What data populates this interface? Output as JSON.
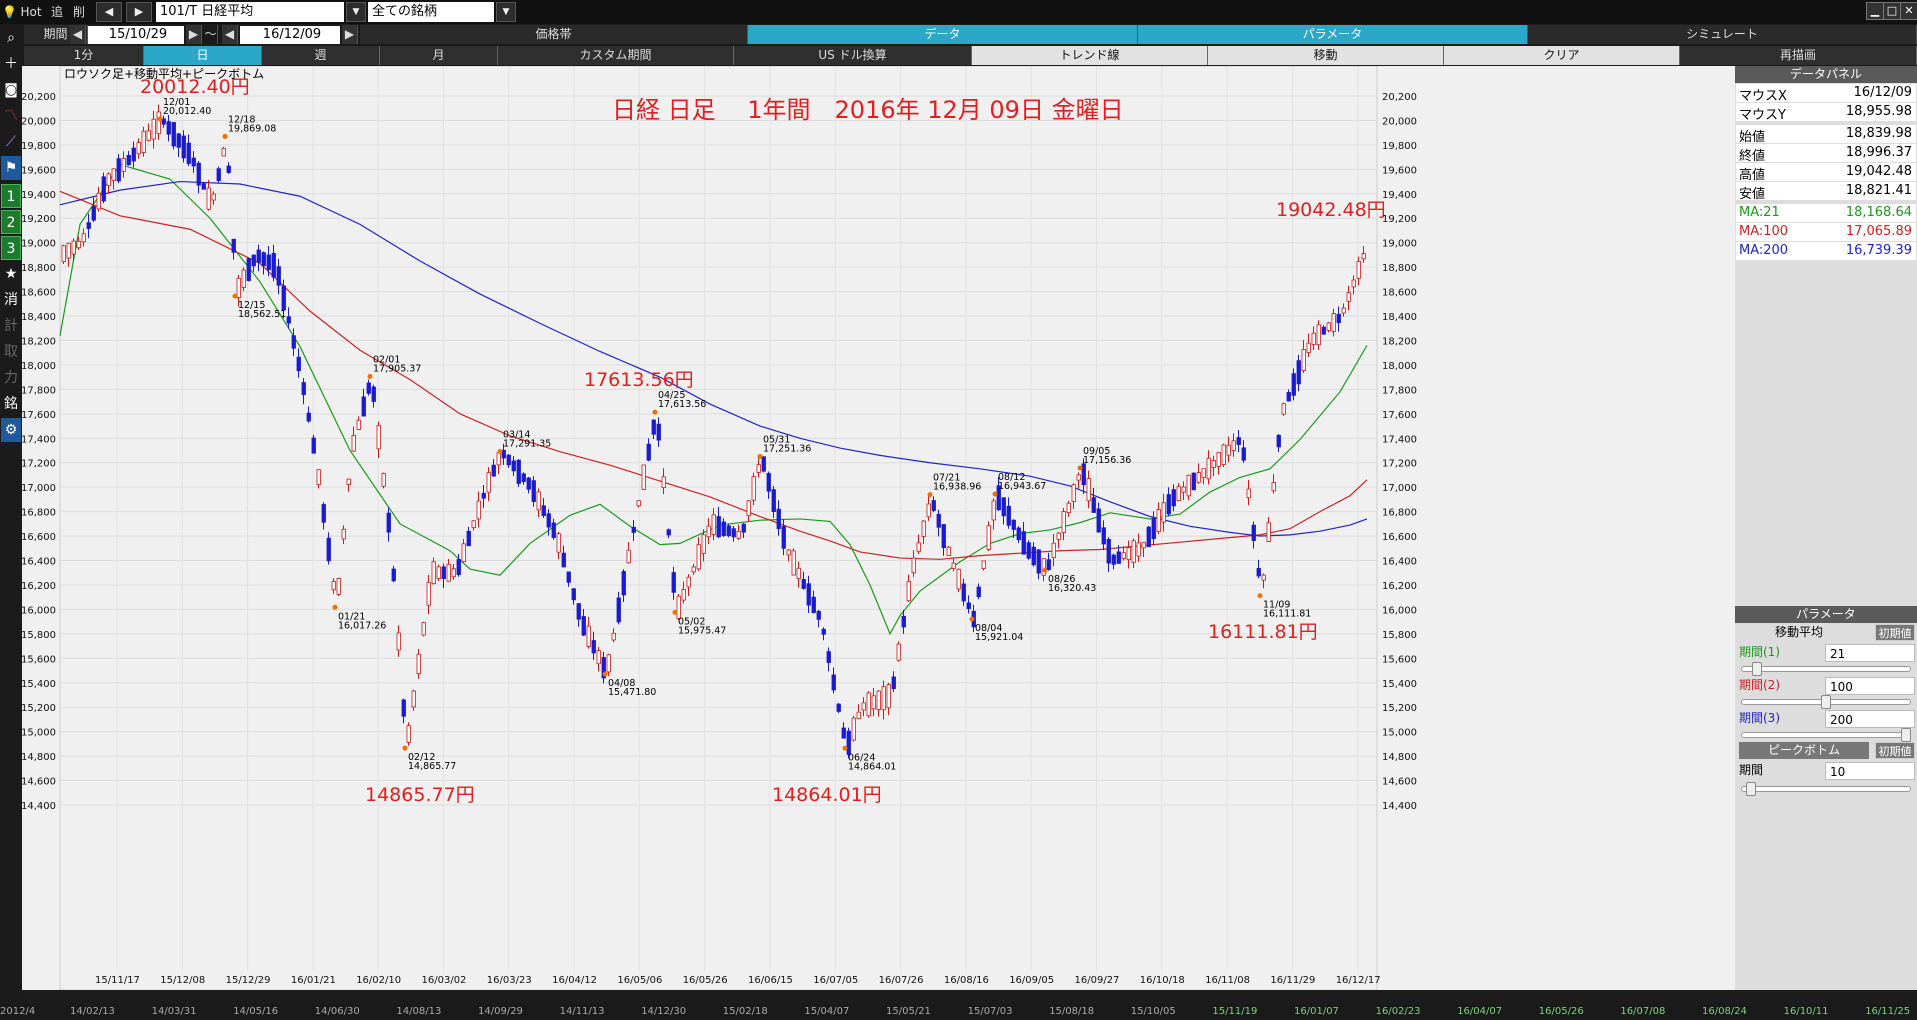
{
  "topbar": {
    "hot": "Hot",
    "tsui": "追",
    "sakujo": "削",
    "symbol": "101/T 日経平均",
    "filter": "全ての銘柄"
  },
  "period_bar": {
    "label": "期間",
    "start": "15/10/29",
    "sep": "～",
    "end": "16/12/09",
    "tabs": [
      "価格帯",
      "データ",
      "パラメータ",
      "シミュレート"
    ],
    "active_tab": "データ"
  },
  "interval_bar": {
    "items": [
      "1分",
      "日",
      "週",
      "月",
      "カスタム期間",
      "US ドル換算",
      "トレンド線",
      "移動",
      "クリア",
      "再描画"
    ],
    "active": "日"
  },
  "toolbar_icons": [
    "search-icon",
    "crosshair-icon",
    "camera-icon",
    "line-chart-icon",
    "trend-icon",
    "flag-icon",
    "1",
    "2",
    "3",
    "star-icon",
    "消",
    "計",
    "取",
    "力",
    "銘",
    "gear-icon"
  ],
  "chart_data": {
    "type": "candlestick",
    "subtitle": "ロウソク足+移動平均+ピークボトム",
    "title": "日経 日足　 1年間　2016年 12月 09日 金曜日",
    "ylim": [
      14400,
      20200
    ],
    "y_ticks": [
      "20,200",
      "20,000",
      "19,800",
      "19,600",
      "19,400",
      "19,200",
      "19,000",
      "18,800",
      "18,600",
      "18,400",
      "18,200",
      "18,000",
      "17,800",
      "17,600",
      "17,400",
      "17,200",
      "17,000",
      "16,800",
      "16,600",
      "16,400",
      "16,200",
      "16,000",
      "15,800",
      "15,600",
      "15,400",
      "15,200",
      "15,000",
      "14,800",
      "14,600",
      "14,400"
    ],
    "x_ticks": [
      "15/11/17",
      "15/12/08",
      "15/12/29",
      "16/01/21",
      "16/02/10",
      "16/03/02",
      "16/03/23",
      "16/04/12",
      "16/05/06",
      "16/05/26",
      "16/06/15",
      "16/07/05",
      "16/07/26",
      "16/08/16",
      "16/09/05",
      "16/09/27",
      "16/10/18",
      "16/11/08",
      "16/11/29",
      "16/12/17"
    ],
    "bottom_ticks": [
      "2012/4",
      "14/02/13",
      "14/03/31",
      "14/05/16",
      "14/06/30",
      "14/08/13",
      "14/09/29",
      "14/11/13",
      "14/12/30",
      "15/02/18",
      "15/04/07",
      "15/05/21",
      "15/07/03",
      "15/08/18",
      "15/10/05",
      "15/11/19",
      "16/01/07",
      "16/02/23",
      "16/04/07",
      "16/05/26",
      "16/07/08",
      "16/08/24",
      "16/10/11",
      "16/11/25"
    ],
    "big_labels": [
      {
        "text": "20012.40円",
        "x": 0,
        "v": 20012.4
      },
      {
        "text": "17613.56円",
        "x": 0,
        "v": 17613.56
      },
      {
        "text": "19042.48円",
        "x": 0,
        "v": 19042.48
      },
      {
        "text": "14865.77円",
        "x": 0,
        "v": 14865.77
      },
      {
        "text": "14864.01円",
        "x": 0,
        "v": 14864.01
      },
      {
        "text": "16111.81円",
        "x": 0,
        "v": 16111.81
      }
    ],
    "peaks": [
      {
        "date": "12/01",
        "value": "20,012.40",
        "v": 20012.4,
        "type": "peak"
      },
      {
        "date": "12/18",
        "value": "19,869.08",
        "v": 19869.08,
        "type": "peak"
      },
      {
        "date": "12/15",
        "value": "18,562.51",
        "v": 18562.51,
        "type": "bottom"
      },
      {
        "date": "02/01",
        "value": "17,905.37",
        "v": 17905.37,
        "type": "peak"
      },
      {
        "date": "01/21",
        "value": "16,017.26",
        "v": 16017.26,
        "type": "bottom"
      },
      {
        "date": "02/12",
        "value": "14,865.77",
        "v": 14865.77,
        "type": "bottom"
      },
      {
        "date": "03/14",
        "value": "17,291.35",
        "v": 17291.35,
        "type": "peak"
      },
      {
        "date": "04/08",
        "value": "15,471.80",
        "v": 15471.8,
        "type": "bottom"
      },
      {
        "date": "04/25",
        "value": "17,613.56",
        "v": 17613.56,
        "type": "peak"
      },
      {
        "date": "05/02",
        "value": "15,975.47",
        "v": 15975.47,
        "type": "bottom"
      },
      {
        "date": "05/31",
        "value": "17,251.36",
        "v": 17251.36,
        "type": "peak"
      },
      {
        "date": "06/24",
        "value": "14,864.01",
        "v": 14864.01,
        "type": "bottom"
      },
      {
        "date": "07/21",
        "value": "16,938.96",
        "v": 16938.96,
        "type": "peak"
      },
      {
        "date": "08/04",
        "value": "15,921.04",
        "v": 15921.04,
        "type": "bottom"
      },
      {
        "date": "08/12",
        "value": "16,943.67",
        "v": 16943.67,
        "type": "peak"
      },
      {
        "date": "08/26",
        "value": "16,320.43",
        "v": 16320.43,
        "type": "bottom"
      },
      {
        "date": "09/05",
        "value": "17,156.36",
        "v": 17156.36,
        "type": "peak"
      },
      {
        "date": "11/09",
        "value": "16,111.81",
        "v": 16111.81,
        "type": "bottom"
      }
    ],
    "series": [
      {
        "name": "MA:21",
        "color": "#1a9a1a",
        "points": [
          [
            0,
            18240
          ],
          [
            20,
            19150
          ],
          [
            60,
            19640
          ],
          [
            110,
            19520
          ],
          [
            150,
            19200
          ],
          [
            200,
            18680
          ],
          [
            240,
            18150
          ],
          [
            290,
            17300
          ],
          [
            340,
            16700
          ],
          [
            390,
            16480
          ],
          [
            410,
            16330
          ],
          [
            440,
            16280
          ],
          [
            470,
            16540
          ],
          [
            510,
            16770
          ],
          [
            540,
            16860
          ],
          [
            570,
            16680
          ],
          [
            600,
            16530
          ],
          [
            620,
            16540
          ],
          [
            660,
            16690
          ],
          [
            700,
            16730
          ],
          [
            740,
            16740
          ],
          [
            770,
            16720
          ],
          [
            790,
            16530
          ],
          [
            810,
            16200
          ],
          [
            830,
            15800
          ],
          [
            840,
            15950
          ],
          [
            860,
            16150
          ],
          [
            900,
            16390
          ],
          [
            930,
            16540
          ],
          [
            960,
            16620
          ],
          [
            990,
            16650
          ],
          [
            1020,
            16710
          ],
          [
            1050,
            16790
          ],
          [
            1090,
            16740
          ],
          [
            1120,
            16780
          ],
          [
            1150,
            16960
          ],
          [
            1180,
            17080
          ],
          [
            1210,
            17150
          ],
          [
            1240,
            17390
          ],
          [
            1280,
            17780
          ],
          [
            1307,
            18160
          ]
        ]
      },
      {
        "name": "MA:100",
        "color": "#cc2222",
        "points": [
          [
            0,
            19420
          ],
          [
            60,
            19220
          ],
          [
            130,
            19110
          ],
          [
            200,
            18830
          ],
          [
            250,
            18440
          ],
          [
            300,
            18120
          ],
          [
            350,
            17880
          ],
          [
            400,
            17600
          ],
          [
            450,
            17420
          ],
          [
            500,
            17290
          ],
          [
            550,
            17180
          ],
          [
            600,
            17050
          ],
          [
            650,
            16920
          ],
          [
            700,
            16760
          ],
          [
            740,
            16640
          ],
          [
            770,
            16560
          ],
          [
            800,
            16470
          ],
          [
            840,
            16420
          ],
          [
            880,
            16410
          ],
          [
            920,
            16440
          ],
          [
            960,
            16460
          ],
          [
            1000,
            16480
          ],
          [
            1040,
            16490
          ],
          [
            1080,
            16520
          ],
          [
            1120,
            16550
          ],
          [
            1160,
            16580
          ],
          [
            1200,
            16610
          ],
          [
            1230,
            16660
          ],
          [
            1260,
            16800
          ],
          [
            1290,
            16930
          ],
          [
            1307,
            17060
          ]
        ]
      },
      {
        "name": "MA:200",
        "color": "#2222cc",
        "points": [
          [
            0,
            19310
          ],
          [
            60,
            19430
          ],
          [
            120,
            19500
          ],
          [
            180,
            19480
          ],
          [
            240,
            19380
          ],
          [
            300,
            19150
          ],
          [
            360,
            18850
          ],
          [
            420,
            18580
          ],
          [
            480,
            18340
          ],
          [
            540,
            18110
          ],
          [
            600,
            17900
          ],
          [
            650,
            17680
          ],
          [
            700,
            17500
          ],
          [
            740,
            17400
          ],
          [
            780,
            17320
          ],
          [
            820,
            17260
          ],
          [
            870,
            17200
          ],
          [
            920,
            17150
          ],
          [
            970,
            17090
          ],
          [
            1010,
            17010
          ],
          [
            1050,
            16880
          ],
          [
            1090,
            16760
          ],
          [
            1130,
            16680
          ],
          [
            1170,
            16630
          ],
          [
            1200,
            16600
          ],
          [
            1230,
            16610
          ],
          [
            1260,
            16640
          ],
          [
            1290,
            16690
          ],
          [
            1307,
            16740
          ]
        ]
      }
    ],
    "candles": []
  },
  "data_panel": {
    "title": "データパネル",
    "rows": [
      {
        "k": "マウスX",
        "v": "16/12/09"
      },
      {
        "k": "マウスY",
        "v": "18,955.98"
      },
      {
        "k": "始値",
        "v": "18,839.98"
      },
      {
        "k": "終値",
        "v": "18,996.37"
      },
      {
        "k": "高値",
        "v": "19,042.48"
      },
      {
        "k": "安値",
        "v": "18,821.41"
      },
      {
        "k": "MA:21",
        "v": "18,168.64",
        "color": "#1a9a1a"
      },
      {
        "k": "MA:100",
        "v": "17,065.89",
        "color": "#cc2222"
      },
      {
        "k": "MA:200",
        "v": "16,739.39",
        "color": "#2222cc"
      }
    ]
  },
  "param_panel": {
    "title": "パラメータ",
    "ma_title": "移動平均",
    "reset": "初期値",
    "periods": [
      {
        "k": "期間(1)",
        "v": "21",
        "color": "#1a9a1a",
        "level": 0.07
      },
      {
        "k": "期間(2)",
        "v": "100",
        "color": "#cc2222",
        "level": 0.5
      },
      {
        "k": "期間(3)",
        "v": "200",
        "color": "#2222cc",
        "level": 1.0
      }
    ],
    "pb_title": "ピークボトム",
    "pb_period": {
      "k": "期間",
      "v": "10",
      "level": 0.03
    }
  }
}
